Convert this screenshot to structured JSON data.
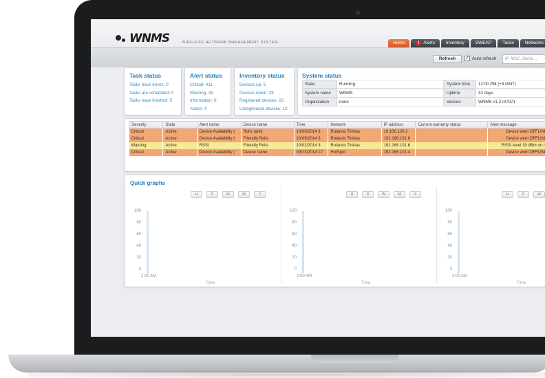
{
  "app": {
    "logo_text": "WNMS",
    "subtitle": "WIRELESS NETWORK MANAGEMENT SYSTEM"
  },
  "tabs": [
    {
      "label": "Home",
      "active": true
    },
    {
      "label": "Alerts",
      "active": false
    },
    {
      "label": "Inventory",
      "active": false
    },
    {
      "label": "SWEAP",
      "active": false
    },
    {
      "label": "Tasks",
      "active": false
    },
    {
      "label": "Networks",
      "active": false
    }
  ],
  "toolbar": {
    "refresh_label": "Refresh",
    "auto_refresh_label": "Auto refresh",
    "auto_refresh_checked": "✓",
    "search_placeholder": "IP, MAC, Serial, ..."
  },
  "task_status": {
    "title": "Task status",
    "lines": [
      "Tasks have errors: 0",
      "Tasks are scheduled: 0",
      "Tasks have finished: 5"
    ]
  },
  "alert_status": {
    "title": "Alert status",
    "lines": [
      "Critical: 411",
      "Warning: 49",
      "Information: 0",
      "Active: 4"
    ]
  },
  "inventory_status": {
    "title": "Inventory status",
    "lines": [
      "Devices up: 5",
      "Devices down: 28",
      "Registered devices: 23",
      "Unregistered devices: 10"
    ]
  },
  "system_status": {
    "title": "System status",
    "left": [
      {
        "label": "State",
        "value": "Running"
      },
      {
        "label": "System name",
        "value": "WNMS"
      },
      {
        "label": "Organization",
        "value": "none"
      }
    ],
    "right": [
      {
        "label": "System time",
        "value": "12:00 PM (+3 GMT)"
      },
      {
        "label": "Uptime",
        "value": "42 days"
      },
      {
        "label": "Version",
        "value": "WNMS v1.2 r47971"
      }
    ]
  },
  "alerts_table": {
    "columns": [
      "Severity",
      "State",
      "Alert name",
      "Device name",
      "Time",
      "Network",
      "IP address",
      "Current warranty status",
      "Alert message"
    ],
    "rows": [
      {
        "severity": "Critical",
        "state": "Active",
        "alert": "Device Availability (",
        "device": "Rolis ranik",
        "time": "10/09/2014 3:",
        "network": "Rolando Tinklas",
        "ip": "10.100.100.2",
        "warranty": "",
        "message": "Device went OFFLINE"
      },
      {
        "severity": "Critical",
        "state": "Active",
        "alert": "Device Availability (",
        "device": "Friendly Rolis",
        "time": "10/09/2014 3:",
        "network": "Rolando Tinklas",
        "ip": "192.168.101.6",
        "warranty": "",
        "message": "Device went OFFLINE"
      },
      {
        "severity": "Warning",
        "state": "Active",
        "alert": "RSSI",
        "device": "Friendly Rolis",
        "time": "10/02/2014 3:",
        "network": "Rolando Tinklas",
        "ip": "192.168.101.6",
        "warranty": "",
        "message": "RSSI level 19 dBm on ra"
      },
      {
        "severity": "Critical",
        "state": "Active",
        "alert": "Device Availability (",
        "device": "Device name",
        "time": "09/23/2014 12",
        "network": "HotSpot",
        "ip": "192.168.101.4",
        "warranty": "",
        "message": "Device went OFFLINE"
      }
    ]
  },
  "quick_graphs": {
    "title": "Quick graphs",
    "range_buttons": [
      "H",
      "D",
      "W",
      "M",
      "Y"
    ],
    "y_ticks": [
      "100",
      "80",
      "60",
      "40",
      "20",
      "0"
    ],
    "x_tick": "2:00 AM",
    "x_label": "Time"
  },
  "colors": {
    "accent_blue": "#1e7fc0",
    "tab_active": "#e06a34",
    "row_critical": "#f3a774",
    "row_warning": "#f6ea97"
  }
}
